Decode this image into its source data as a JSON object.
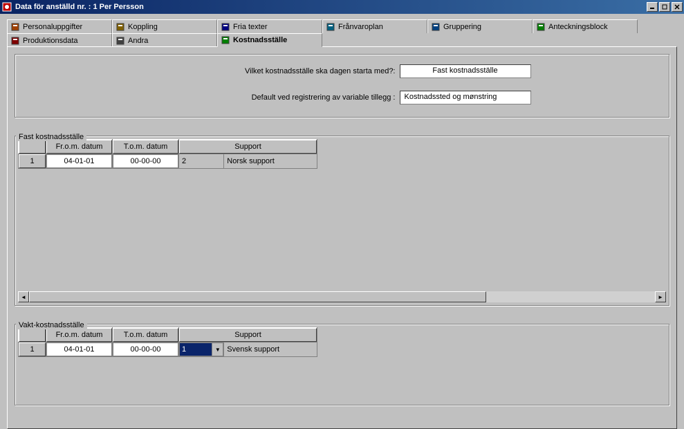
{
  "window": {
    "title": "Data för anställd nr. : 1 Per Persson"
  },
  "tabs": {
    "row1": [
      {
        "label": "Personaluppgifter",
        "icon": "person-card-icon",
        "color": "#a04000"
      },
      {
        "label": "Koppling",
        "icon": "link-icon",
        "color": "#806000"
      },
      {
        "label": "Fria texter",
        "icon": "text-icon",
        "color": "#000080"
      },
      {
        "label": "Frånvaroplan",
        "icon": "calendar-icon",
        "color": "#006080"
      },
      {
        "label": "Gruppering",
        "icon": "stack-icon",
        "color": "#004080"
      },
      {
        "label": "Anteckningsblock",
        "icon": "notes-icon",
        "color": "#008000"
      }
    ],
    "row2": [
      {
        "label": "Produktionsdata",
        "icon": "factory-icon",
        "color": "#800000"
      },
      {
        "label": "Andra",
        "icon": "book-icon",
        "color": "#404040"
      },
      {
        "label": "Kostnadsställe",
        "icon": "money-icon",
        "color": "#008000",
        "active": true
      }
    ]
  },
  "fields": {
    "day_start_label": "Vilket kostnadsställe ska dagen starta med?:",
    "day_start_value": "Fast kostnadsställe",
    "default_reg_label": "Default ved registrering av variable tillegg :",
    "default_reg_value": "Kostnadssted og mønstring"
  },
  "grid_fixed": {
    "legend": "Fast kostnadsställe",
    "headers": {
      "from": "Fr.o.m. datum",
      "to": "T.o.m. datum",
      "support": "Support"
    },
    "rows": [
      {
        "num": "1",
        "from": "04-01-01",
        "to": "00-00-00",
        "code": "2",
        "desc": "Norsk support"
      }
    ]
  },
  "grid_vakt": {
    "legend": "Vakt-kostnadsställe",
    "headers": {
      "from": "Fr.o.m. datum",
      "to": "T.o.m. datum",
      "support": "Support"
    },
    "rows": [
      {
        "num": "1",
        "from": "04-01-01",
        "to": "00-00-00",
        "code": "1",
        "desc": "Svensk support"
      }
    ]
  }
}
